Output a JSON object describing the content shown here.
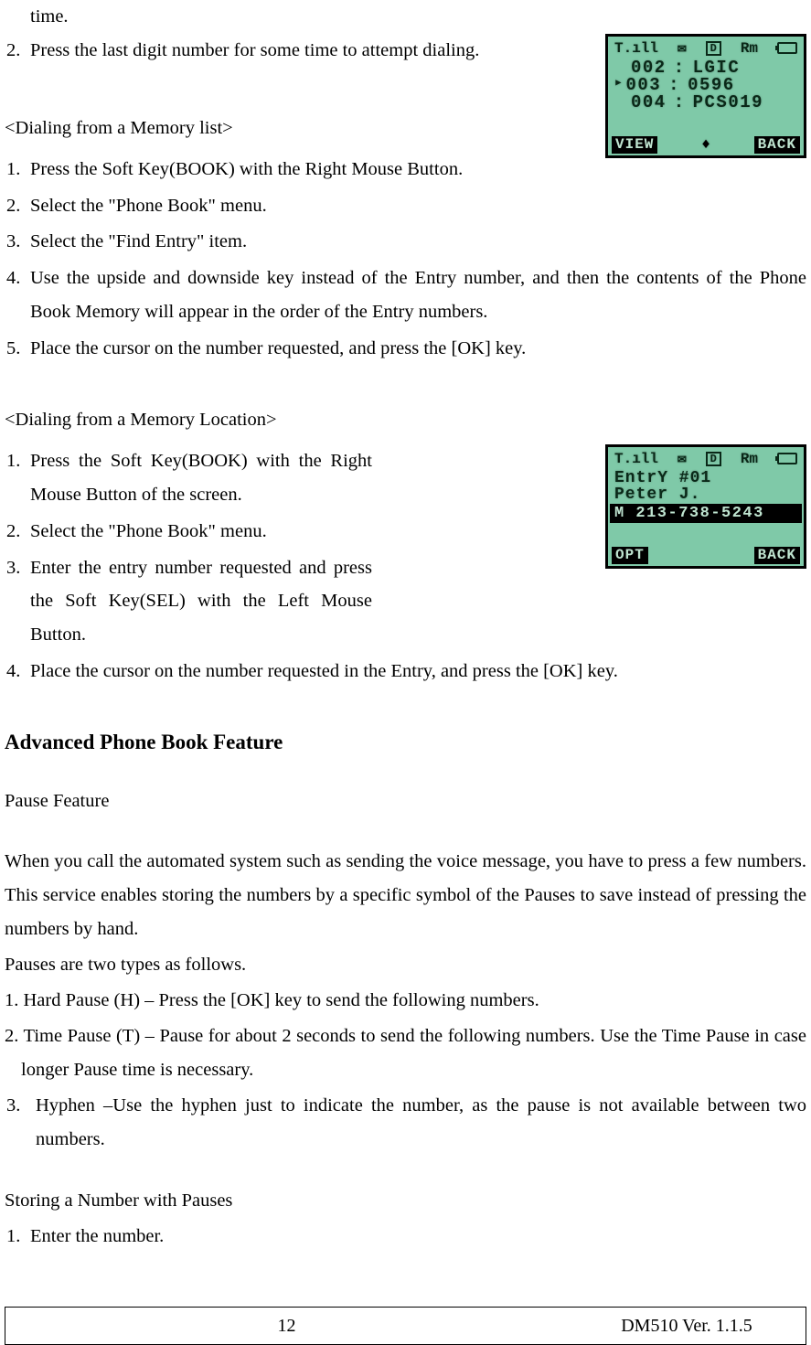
{
  "top": {
    "fragment": "time.",
    "step2_num": "2.",
    "step2_text": "Press the last digit number for some time to attempt dialing."
  },
  "memlist": {
    "heading": "<Dialing from a Memory list>",
    "s1_num": "1.",
    "s1_text": "Press the Soft Key(BOOK) with the Right Mouse Button.",
    "s2_num": "2.",
    "s2_text": "Select the \"Phone Book\" menu.",
    "s3_num": "3.",
    "s3_text": "Select the \"Find Entry\" item.",
    "s4_num": "4.",
    "s4_text": "Use the upside and downside key instead of the Entry number, and then the contents of the Phone Book Memory will appear in the order of the Entry numbers.",
    "s5_num": "5.",
    "s5_text": "Place the cursor on the number requested, and press the [OK] key."
  },
  "memloc": {
    "heading": "<Dialing from a Memory Location>",
    "s1_num": "1.",
    "s1_text": "Press the Soft Key(BOOK) with the Right Mouse Button of the screen.",
    "s2_num": "2.",
    "s2_text": "Select the \"Phone Book\" menu.",
    "s3_num": "3.",
    "s3_text": "Enter the entry number requested and press the Soft Key(SEL) with the Left Mouse Button.",
    "s4_num": "4.",
    "s4_text": "Place the cursor on the number requested in the Entry, and press the [OK] key."
  },
  "advanced": {
    "heading": "Advanced Phone Book Feature",
    "sub": "Pause Feature",
    "para": "When you call the automated system such as sending the voice message, you have to press a few numbers. This service enables storing the numbers by a specific symbol of the Pauses to save instead of pressing the numbers by hand.",
    "types": "Pauses are two types as follows.",
    "t1": "1. Hard Pause (H) – Press the [OK] key to send the following numbers.",
    "t2": "2. Time Pause (T) – Pause for about 2 seconds to send the following numbers. Use the Time Pause in case longer Pause time is necessary.",
    "t3_num": "3.",
    "t3_text": "Hyphen –Use the hyphen just to indicate the number, as the pause is not available between two numbers.",
    "storing_head": "Storing a Number with Pauses",
    "storing_s1_num": "1.",
    "storing_s1_text": "Enter the number."
  },
  "screen1": {
    "signal": "T.ıll",
    "mail": "✉",
    "d": "D",
    "rm": "Rm",
    "r1_n": "002",
    "r1_v": "LGIC",
    "r2_cur": "▸",
    "r2_n": "003",
    "r2_v": "0596",
    "r3_n": "004",
    "r3_v": "PCS019",
    "left": "VIEW",
    "arrow": "♦",
    "right": "BACK"
  },
  "screen2": {
    "signal": "T.ıll",
    "mail": "✉",
    "d": "D",
    "rm": "Rm",
    "entry": "EntrY #01",
    "name": "Peter J.",
    "num": "M 213-738-5243",
    "left": "OPT",
    "right": "BACK"
  },
  "footer": {
    "page": "12",
    "ver": "DM510    Ver. 1.1.5"
  }
}
